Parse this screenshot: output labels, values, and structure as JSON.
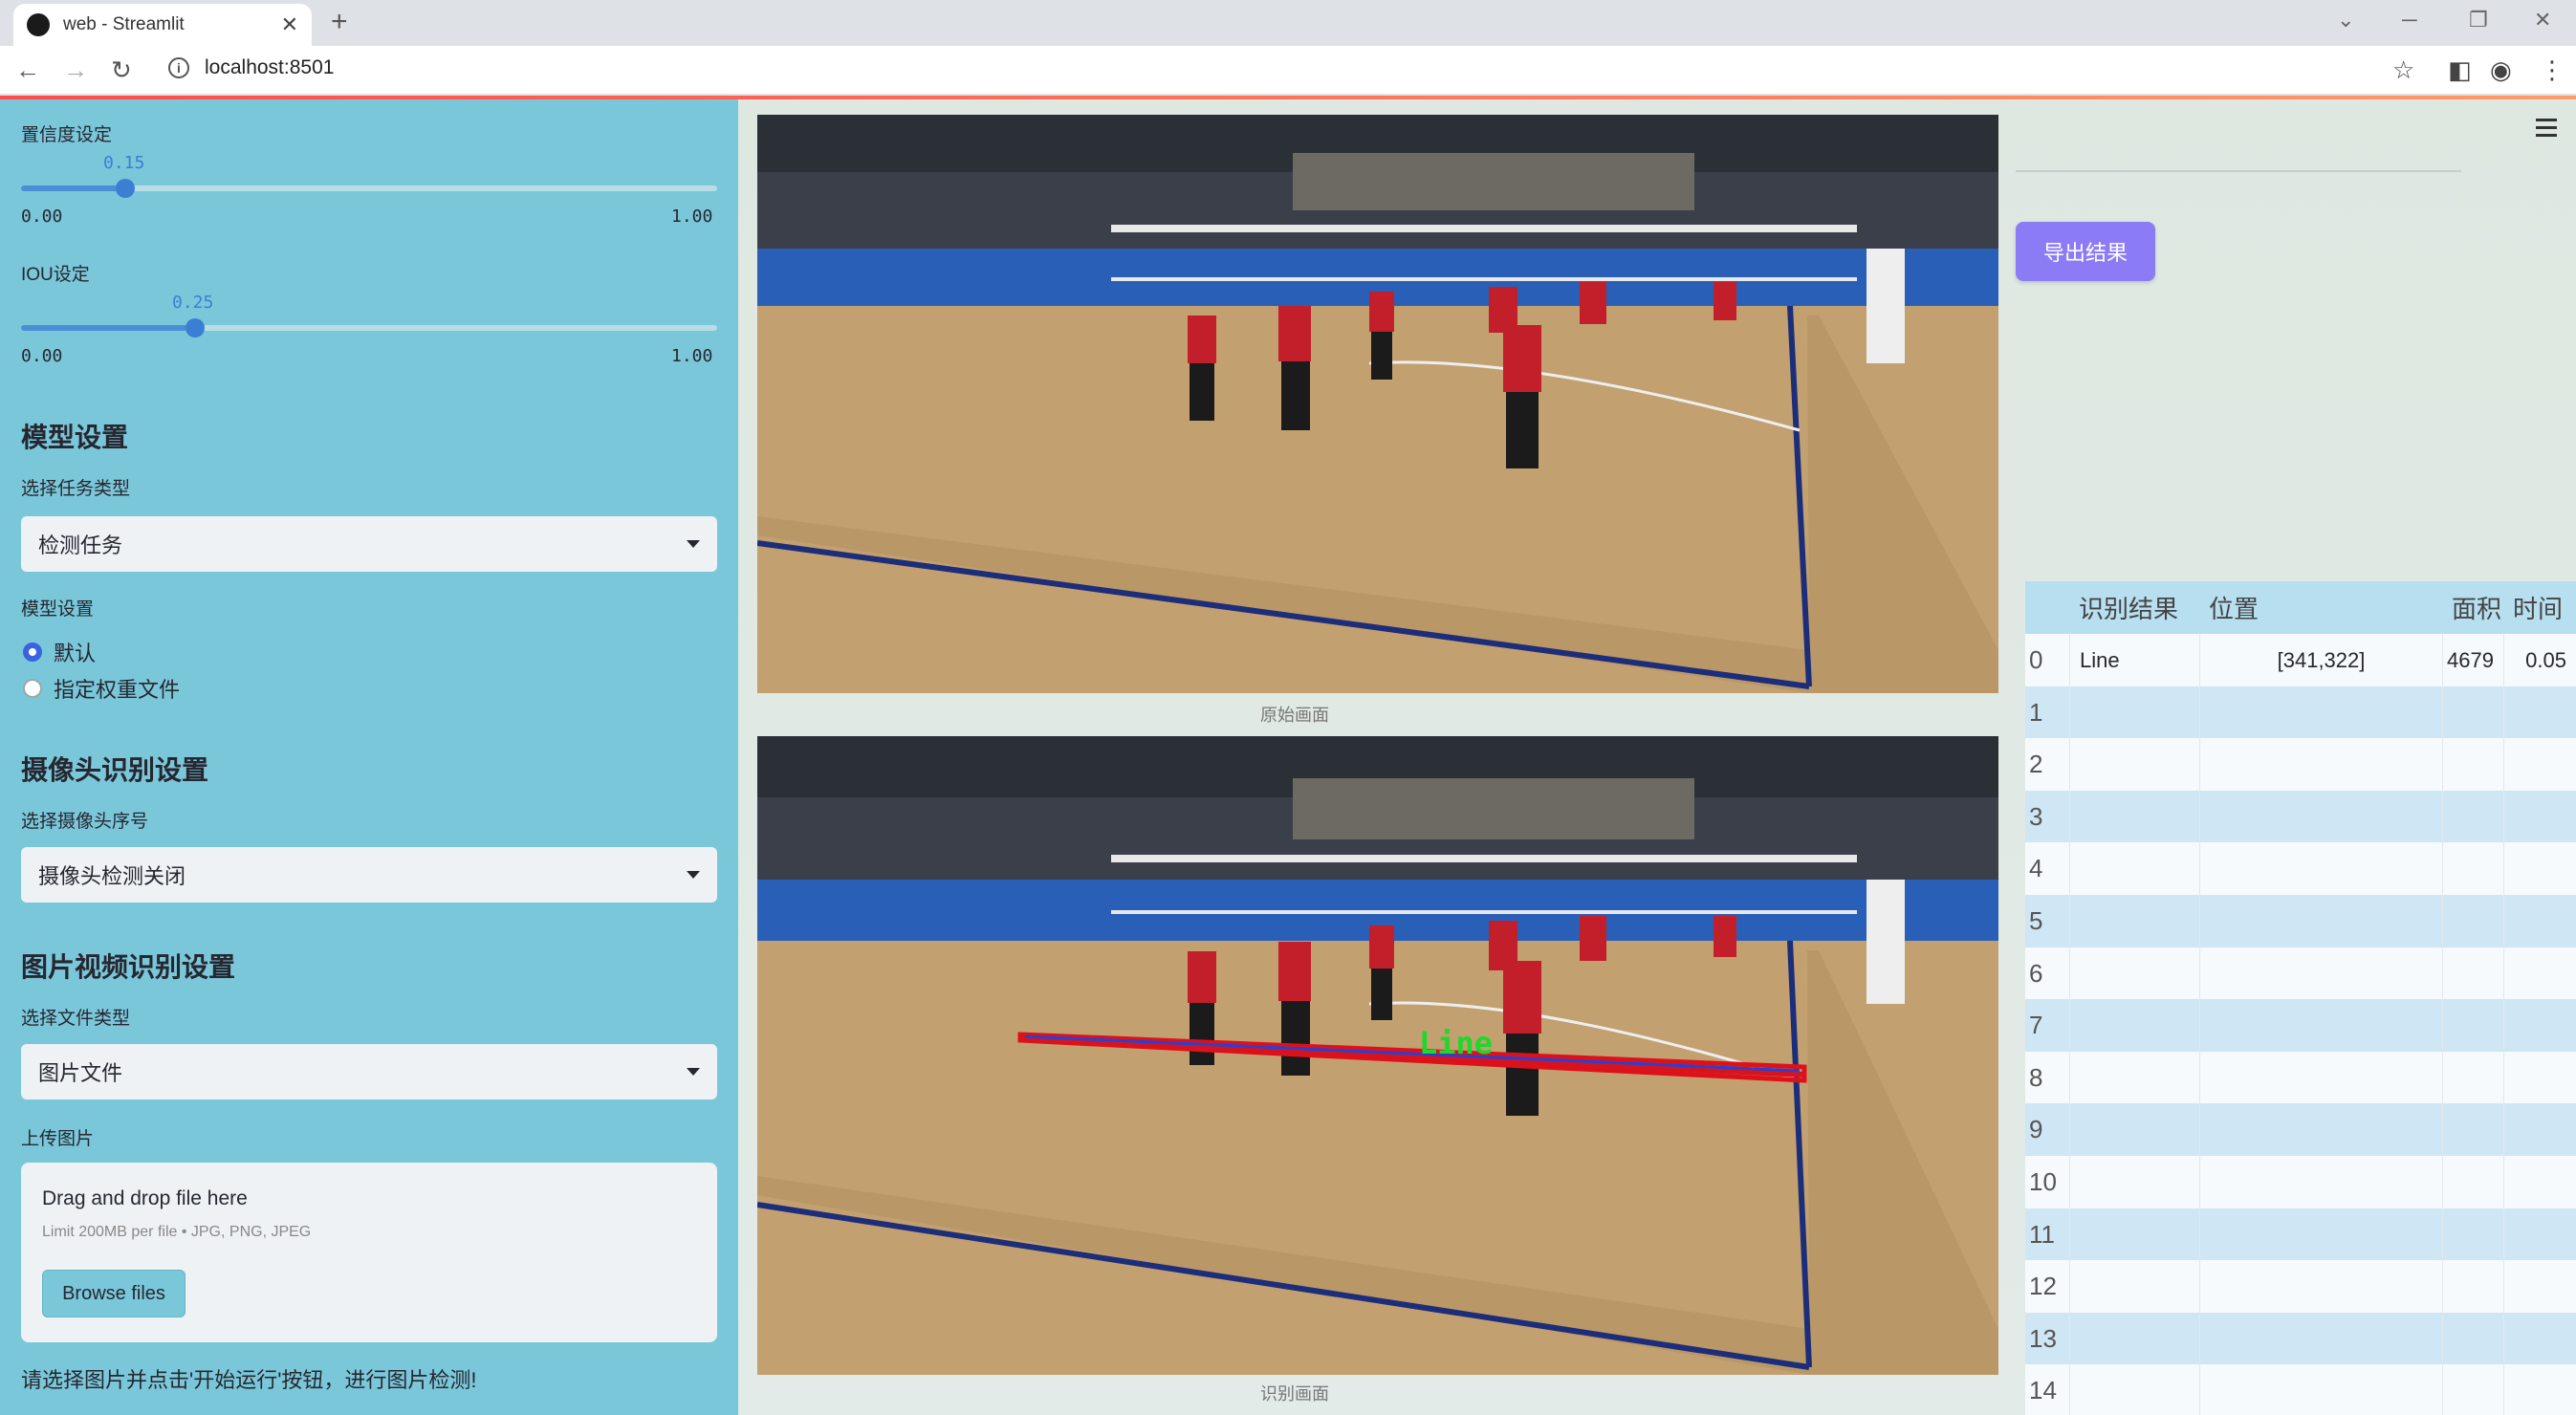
{
  "browser": {
    "tab_title": "web - Streamlit",
    "url": "localhost:8501"
  },
  "sidebar": {
    "conf_label": "置信度设定",
    "conf_value": "0.15",
    "conf_fraction": 0.15,
    "conf_min": "0.00",
    "conf_max": "1.00",
    "iou_label": "IOU设定",
    "iou_value": "0.25",
    "iou_fraction": 0.25,
    "iou_min": "0.00",
    "iou_max": "1.00",
    "model_header": "模型设置",
    "task_label": "选择任务类型",
    "task_value": "检测任务",
    "model_label": "模型设置",
    "radio_default": "默认",
    "radio_custom": "指定权重文件",
    "camera_header": "摄像头识别设置",
    "camera_label": "选择摄像头序号",
    "camera_value": "摄像头检测关闭",
    "file_header": "图片视频识别设置",
    "file_type_label": "选择文件类型",
    "file_type_value": "图片文件",
    "upload_label": "上传图片",
    "upload_title": "Drag and drop file here",
    "upload_limit": "Limit 200MB per file • JPG, PNG, JPEG",
    "browse_label": "Browse files",
    "hint": "请选择图片并点击'开始运行'按钮，进行图片检测!"
  },
  "main": {
    "caption_original": "原始画面",
    "caption_result": "识别画面",
    "detection_label": "Line",
    "export_label": "导出结果"
  },
  "table": {
    "headers": [
      "识别结果",
      "位置",
      "面积",
      "时间"
    ],
    "rows": [
      {
        "idx": "0",
        "label": "Line",
        "pos": "[341,322]",
        "area": "4679",
        "time": "0.05"
      },
      {
        "idx": "1"
      },
      {
        "idx": "2"
      },
      {
        "idx": "3"
      },
      {
        "idx": "4"
      },
      {
        "idx": "5"
      },
      {
        "idx": "6"
      },
      {
        "idx": "7"
      },
      {
        "idx": "8"
      },
      {
        "idx": "9"
      },
      {
        "idx": "10"
      },
      {
        "idx": "11"
      },
      {
        "idx": "12"
      },
      {
        "idx": "13"
      },
      {
        "idx": "14"
      }
    ]
  }
}
